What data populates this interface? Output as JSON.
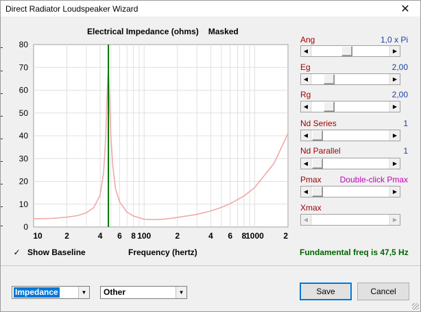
{
  "window": {
    "title": "Direct Radiator Loudspeaker Wizard",
    "close_glyph": "✕"
  },
  "chart_header": {
    "title": "Electrical Impedance (ohms)",
    "mode": "Masked"
  },
  "chart_data": {
    "type": "line",
    "title": "Electrical Impedance (ohms)",
    "xlabel": "Frequency (hertz)",
    "ylabel": "",
    "x_scale": "log",
    "xlim": [
      10,
      2000
    ],
    "ylim": [
      0,
      80
    ],
    "y_ticks": [
      0,
      10,
      20,
      30,
      40,
      50,
      60,
      70,
      80
    ],
    "x_tick_values": [
      10,
      20,
      40,
      60,
      80,
      100,
      200,
      400,
      600,
      800,
      1000,
      2000
    ],
    "x_tick_labels": [
      "10",
      "2",
      "4",
      "6",
      "8",
      "100",
      "2",
      "4",
      "6",
      "8",
      "1000",
      "2"
    ],
    "grid": true,
    "series": [
      {
        "color": "#f0a8a8",
        "x": [
          10,
          15,
          20,
          25,
          30,
          35,
          40,
          43,
          45,
          46,
          47,
          47.5,
          48,
          49,
          50,
          52,
          55,
          60,
          70,
          80,
          100,
          120,
          150,
          200,
          300,
          400,
          500,
          600,
          800,
          1000,
          1500,
          2000
        ],
        "y": [
          3.6,
          3.8,
          4.3,
          5.0,
          6.2,
          8.5,
          14,
          24,
          40,
          55,
          66,
          68,
          64,
          52,
          40,
          27,
          17,
          11,
          6.5,
          4.8,
          3.4,
          3.2,
          3.4,
          4.2,
          5.5,
          7.0,
          8.6,
          10.2,
          13.6,
          17.3,
          28,
          41
        ]
      },
      {
        "color": "#007000",
        "x": [
          47.5,
          47.5
        ],
        "y": [
          0,
          80
        ]
      }
    ]
  },
  "show_baseline": {
    "label": "Show Baseline",
    "checked": "✓"
  },
  "freq_axis_label": "Frequency (hertz)",
  "fundamental": "Fundamental freq is 47,5 Hz",
  "params": [
    {
      "label": "Ang",
      "value": "1,0 x Pi",
      "thumb": 0.45,
      "enabled": true
    },
    {
      "label": "Eg",
      "value": "2,00",
      "thumb": 0.18,
      "enabled": true
    },
    {
      "label": "Rg",
      "value": "2,00",
      "thumb": 0.18,
      "enabled": true
    },
    {
      "label": "Nd  Series",
      "value": "1",
      "thumb": 0.0,
      "enabled": true
    },
    {
      "label": "Nd  Parallel",
      "value": "1",
      "thumb": 0.0,
      "enabled": true
    },
    {
      "label": "Pmax",
      "value": "Double-click Pmax",
      "thumb": 0.0,
      "enabled": true
    },
    {
      "label": "Xmax",
      "value": "",
      "thumb": null,
      "enabled": false
    }
  ],
  "dropdowns": {
    "graph_type": "Impedance",
    "other": "Other"
  },
  "buttons": {
    "save": "Save",
    "cancel": "Cancel"
  },
  "colors": {
    "curve": "#f0a8a8",
    "marker": "#007000",
    "label_red": "#a00000",
    "value_blue": "#1a3fa8",
    "fund_green": "#006400"
  }
}
